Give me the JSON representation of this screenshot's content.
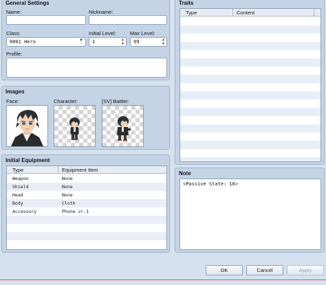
{
  "general": {
    "title": "General Settings",
    "name_label": "Name:",
    "name_value": "",
    "nickname_label": "Nickname:",
    "nickname_value": "",
    "class_label": "Class:",
    "class_value": "0001 Hero",
    "initial_level_label": "Initial Level:",
    "initial_level_value": "1",
    "max_level_label": "Max Level:",
    "max_level_value": "99",
    "profile_label": "Profile:",
    "profile_value": ""
  },
  "images": {
    "title": "Images",
    "face_label": "Face:",
    "character_label": "Character:",
    "battler_label": "[SV] Battler:"
  },
  "equipment": {
    "title": "Initial Equipment",
    "col_type": "Type",
    "col_item": "Equipment Item",
    "rows": [
      {
        "type": "Weapon",
        "item": "None"
      },
      {
        "type": "Shield",
        "item": "None"
      },
      {
        "type": "Head",
        "item": "None"
      },
      {
        "type": "Body",
        "item": "Cloth"
      },
      {
        "type": "Accessory",
        "item": "Phone vr.1"
      }
    ]
  },
  "traits": {
    "title": "Traits",
    "col_type": "Type",
    "col_content": "Content"
  },
  "note": {
    "title": "Note",
    "value": "<Passive State: 16>"
  },
  "buttons": {
    "ok": "OK",
    "cancel": "Cancel",
    "apply": "Apply"
  },
  "colors": {
    "panel": "#c4d4e6",
    "background": "#d5e1ee",
    "alt_row": "#e9eef6"
  }
}
